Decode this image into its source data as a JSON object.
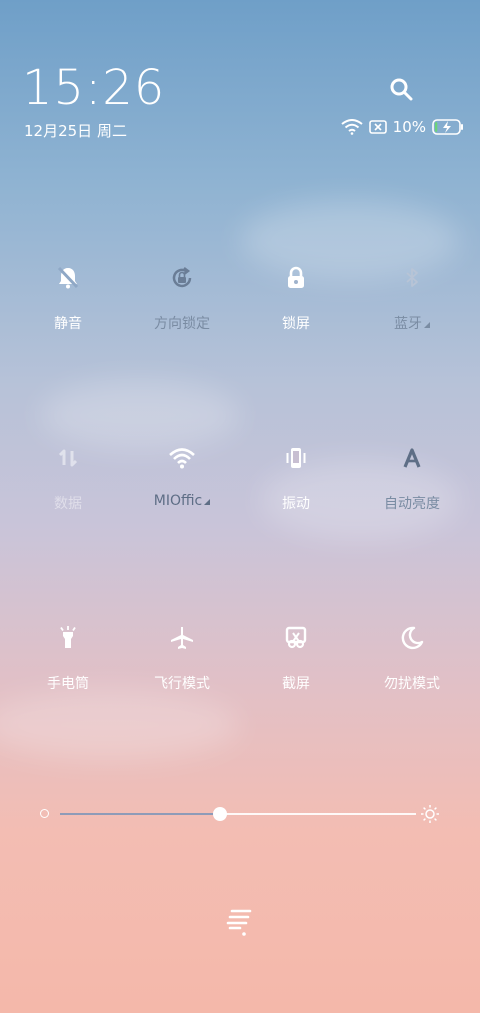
{
  "header": {
    "time": "15:26",
    "date": "12月25日 周二",
    "battery_percent": "10%",
    "battery_level": 0.1
  },
  "tiles": [
    {
      "label": "静音",
      "icon": "mute-bell-icon"
    },
    {
      "label": "方向锁定",
      "icon": "rotation-lock-icon"
    },
    {
      "label": "锁屏",
      "icon": "lock-icon"
    },
    {
      "label": "蓝牙",
      "icon": "bluetooth-icon"
    },
    {
      "label": "数据",
      "icon": "mobile-data-icon"
    },
    {
      "label": "MIOffic",
      "icon": "wifi-icon"
    },
    {
      "label": "振动",
      "icon": "vibrate-icon"
    },
    {
      "label": "自动亮度",
      "icon": "auto-brightness-icon"
    },
    {
      "label": "手电筒",
      "icon": "flashlight-icon"
    },
    {
      "label": "飞行模式",
      "icon": "airplane-icon"
    },
    {
      "label": "截屏",
      "icon": "screenshot-icon"
    },
    {
      "label": "勿扰模式",
      "icon": "moon-icon"
    }
  ],
  "brightness": {
    "level": 0.45
  }
}
